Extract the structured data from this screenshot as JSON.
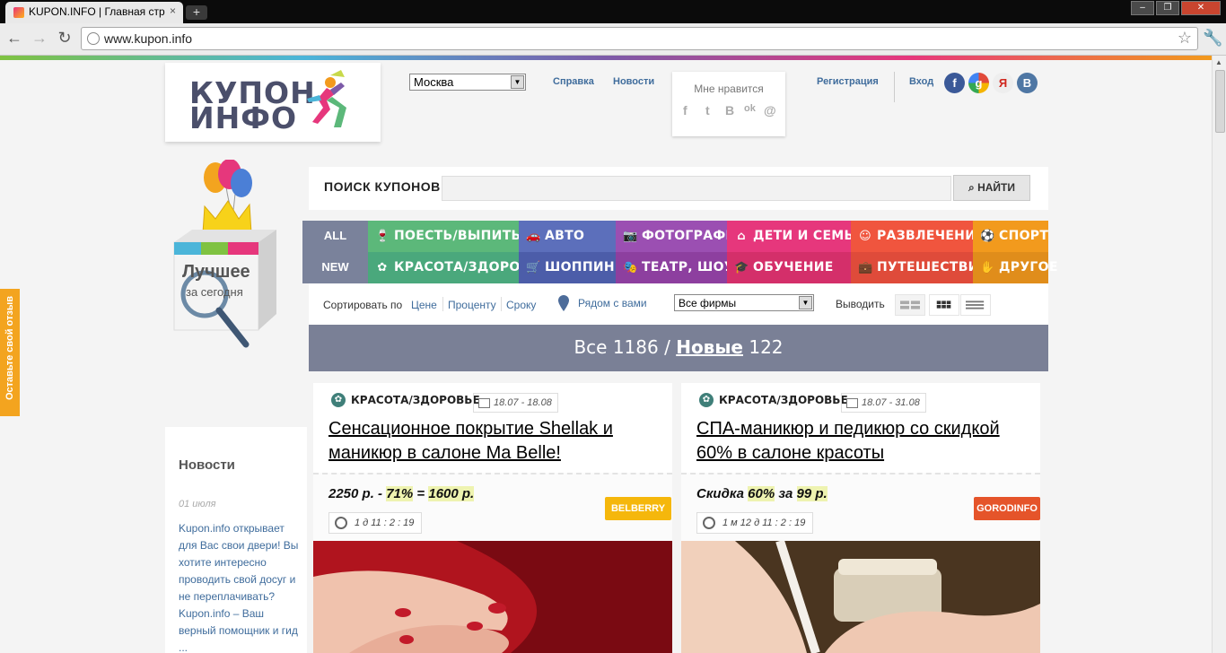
{
  "browser": {
    "tab_title": "KUPON.INFO | Главная стр",
    "tab_close": "×",
    "new_tab": "+",
    "url": "www.kupon.info",
    "window_min": "–",
    "window_max": "❐",
    "window_close": "✕"
  },
  "feedback": {
    "label": "Оставьте свой отзыв"
  },
  "logo": {
    "line1": "КУПОН",
    "line2": "ИНФО"
  },
  "header": {
    "city": "Москва",
    "links": {
      "help": "Справка",
      "news": "Новости",
      "register": "Регистрация",
      "login": "Вход"
    },
    "like_title": "Мне нравится",
    "like_icons": [
      "f",
      "t",
      "B",
      "ok",
      "@"
    ],
    "social": {
      "fb": "f",
      "google": "g",
      "yandex": "Я",
      "vk": "B"
    }
  },
  "promo": {
    "line1": "Лучшее",
    "line2": "за сегодня"
  },
  "search": {
    "label": "ПОИСК КУПОНОВ",
    "button": "НАЙТИ",
    "placeholder": ""
  },
  "categories": {
    "all_label": "ALL",
    "new_label": "NEW",
    "row1": [
      {
        "label": "ПОЕСТЬ/ВЫПИТЬ",
        "icon": "glass-icon",
        "glyph": "🍷",
        "color": "#5cb87a"
      },
      {
        "label": "АВТО",
        "icon": "car-icon",
        "glyph": "🚗",
        "color": "#5c6fbb"
      },
      {
        "label": "ФОТОГРАФИЯ",
        "icon": "camera-icon",
        "glyph": "📷",
        "color": "#9b4fb2"
      },
      {
        "label": "ДЕТИ И СЕМЬЯ",
        "icon": "house-icon",
        "glyph": "⌂",
        "color": "#e6377c"
      },
      {
        "label": "РАЗВЛЕЧЕНИЯ",
        "icon": "smile-icon",
        "glyph": "☺",
        "color": "#f0553e"
      },
      {
        "label": "СПОРТ",
        "icon": "ball-icon",
        "glyph": "⚽",
        "color": "#f29a1d"
      }
    ],
    "row2": [
      {
        "label": "КРАСОТА/ЗДОРОВЬЕ",
        "icon": "flower-icon",
        "glyph": "✿",
        "color": "#4aa87c"
      },
      {
        "label": "ШОППИНГ",
        "icon": "basket-icon",
        "glyph": "🛒",
        "color": "#4c5da9"
      },
      {
        "label": "ТЕАТР, ШОУ",
        "icon": "mask-icon",
        "glyph": "🎭",
        "color": "#8d3f9f"
      },
      {
        "label": "ОБУЧЕНИЕ",
        "icon": "graduation-cap-icon",
        "glyph": "🎓",
        "color": "#d42f6a"
      },
      {
        "label": "ПУТЕШЕСТВИЯ",
        "icon": "suitcase-icon",
        "glyph": "💼",
        "color": "#df4b3a"
      },
      {
        "label": "ДРУГОЕ",
        "icon": "hand-icon",
        "glyph": "✋",
        "color": "#e08d1b"
      }
    ]
  },
  "sort": {
    "label": "Сортировать по",
    "options": [
      "Цене",
      "Проценту",
      "Сроку"
    ],
    "nearby": "Рядом с вами",
    "firms": "Все фирмы",
    "output_label": "Выводить"
  },
  "counts": {
    "all_label": "Все",
    "all_count": "1186",
    "separator": "/",
    "new_label": "Новые",
    "new_count": "122"
  },
  "news": {
    "title": "Новости",
    "date": "01 июля",
    "text": "Kupon.info открывает для Вас свои двери! Вы хотите интересно проводить свой досуг и не переплачивать? Kupon.info – Ваш верный помощник и гид ..."
  },
  "deals": [
    {
      "category": "КРАСОТА/ЗДОРОВЬЕ",
      "dates": "18.07 - 18.08",
      "title": "Сенсационное покрытие Shellak и маникюр в салоне Ma Belle!",
      "price_old": "2250 р.",
      "discount": "71%",
      "price_new": "1600 р.",
      "timer": "1 д 11 : 2 : 19",
      "brand": "BELBERRY",
      "brand_color": "#f5b70c"
    },
    {
      "category": "КРАСОТА/ЗДОРОВЬЕ",
      "dates": "18.07 - 31.08",
      "title": "СПА-маникюр и педикюр со скидкой 60% в салоне красоты",
      "price_prefix": "Скидка",
      "discount": "60%",
      "price_mid": "за",
      "price_new": "99 р.",
      "timer": "1 м 12 д 11 : 2 : 19",
      "brand": "GORODINFO",
      "brand_color": "#e5542a"
    }
  ]
}
